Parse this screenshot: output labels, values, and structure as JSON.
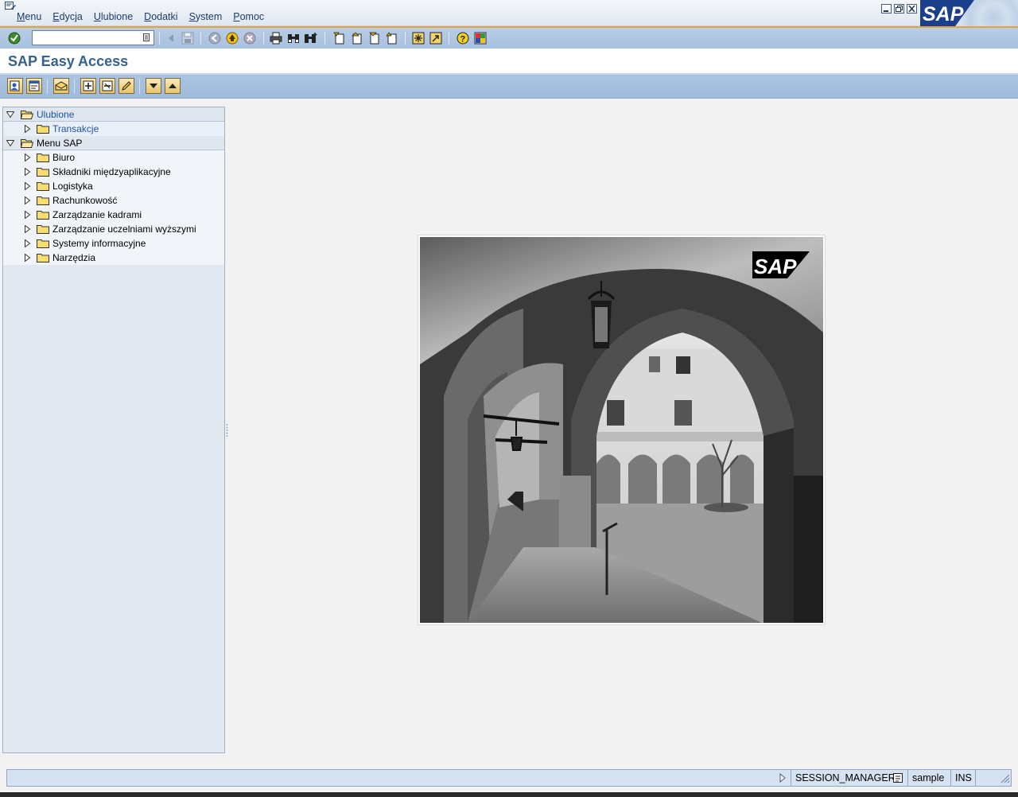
{
  "menubar": {
    "items": [
      {
        "label": "Menu",
        "underline": "M",
        "rest": "enu"
      },
      {
        "label": "Edycja",
        "underline": "E",
        "rest": "dycja"
      },
      {
        "label": "Ulubione",
        "underline": "U",
        "rest": "lubione"
      },
      {
        "label": "Dodatki",
        "underline": "D",
        "rest": "odatki"
      },
      {
        "label": "System",
        "underline": "S",
        "rest": "ystem"
      },
      {
        "label": "Pomoc",
        "underline": "P",
        "rest": "omoc"
      }
    ],
    "logo_text": "SAP"
  },
  "toolbar": {
    "command_field_value": ""
  },
  "title": "SAP Easy Access",
  "tree": {
    "favorites_label": "Ulubione",
    "favorites_children": [
      "Transakcje"
    ],
    "menu_label": "Menu SAP",
    "menu_children": [
      "Biuro",
      "Składniki międzyaplikacyjne",
      "Logistyka",
      "Rachunkowość",
      "Zarządzanie kadrami",
      "Zarządzanie uczelniami wyższymi",
      "Systemy informacyjne",
      "Narzędzia"
    ]
  },
  "image": {
    "logo_text": "SAP"
  },
  "statusbar": {
    "transaction": "SESSION_MANAGER",
    "client": "sample",
    "mode": "INS"
  },
  "colors": {
    "title": "#35618f",
    "tree_link": "#1c55a4",
    "toolbar_accent": "#e8a23a",
    "sap_blue": "#1b3f8b"
  }
}
